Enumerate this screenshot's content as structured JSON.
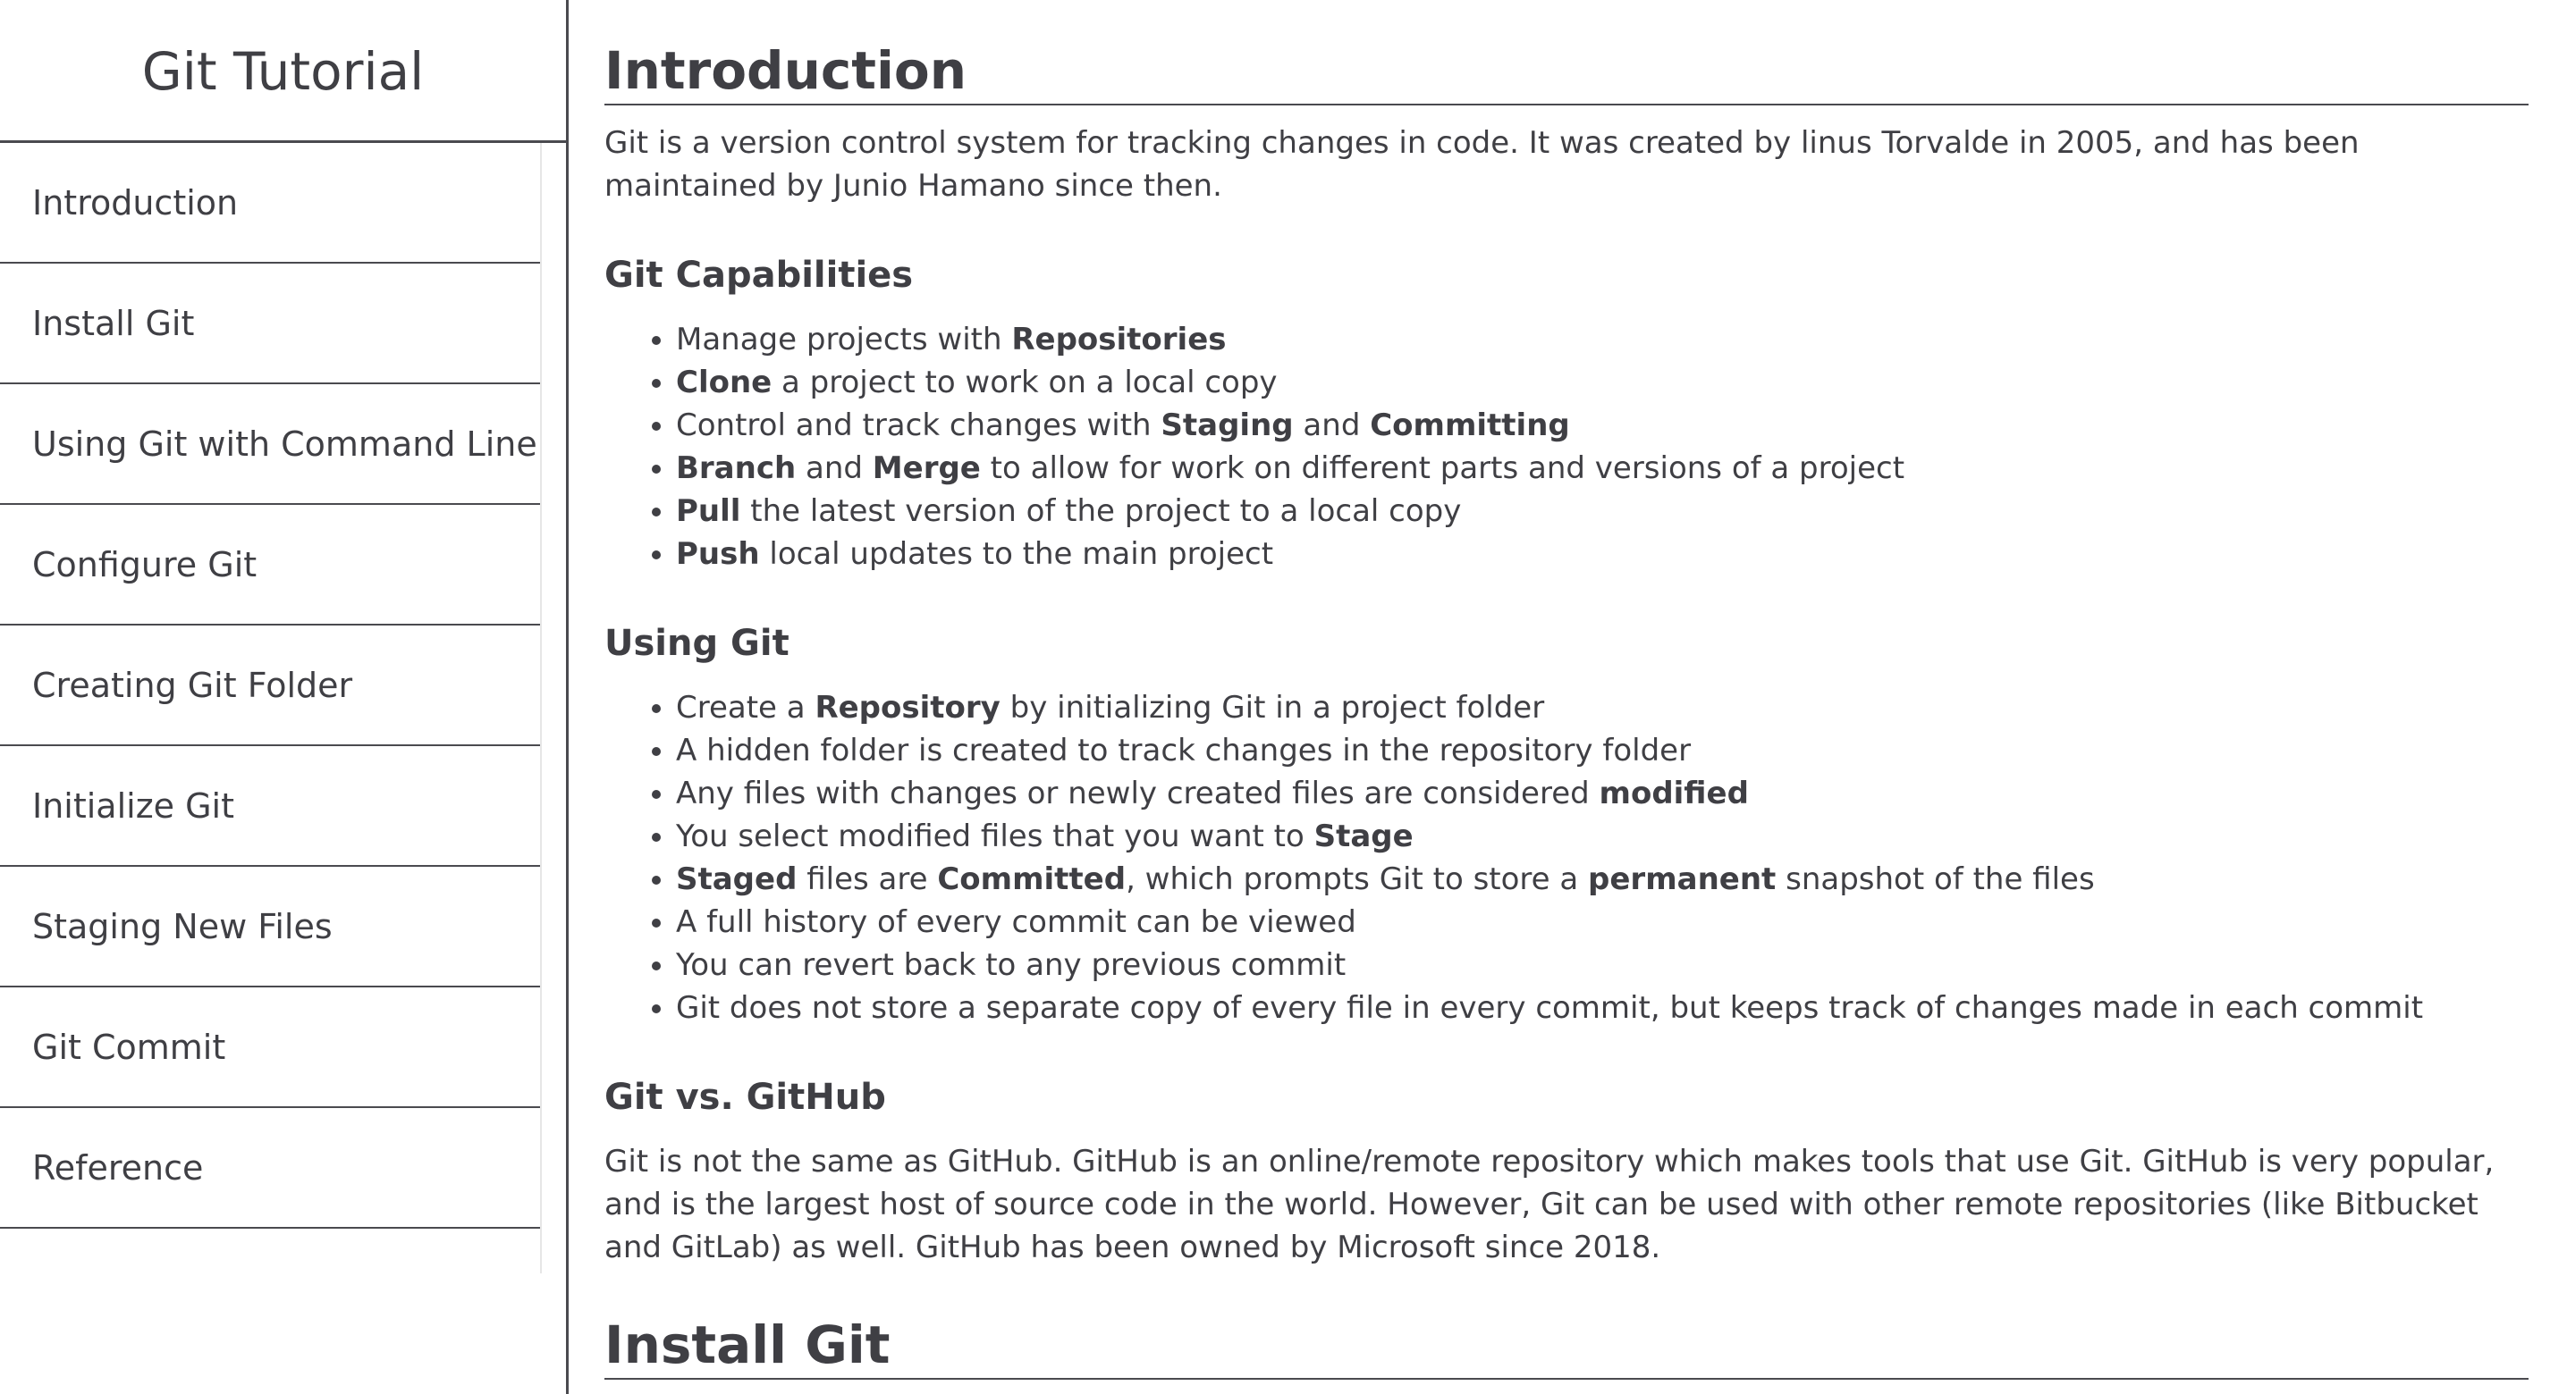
{
  "sidebar": {
    "title": "Git Tutorial",
    "items": [
      {
        "label": "Introduction"
      },
      {
        "label": "Install Git"
      },
      {
        "label": "Using Git with Command Line"
      },
      {
        "label": "Configure Git"
      },
      {
        "label": "Creating Git Folder"
      },
      {
        "label": "Initialize Git"
      },
      {
        "label": "Staging New Files"
      },
      {
        "label": "Git Commit"
      },
      {
        "label": "Reference"
      }
    ]
  },
  "main": {
    "intro_title": "Introduction",
    "intro_paragraph": "Git is a version control system for tracking changes in code. It was created by linus Torvalde in 2005, and has been maintained by Junio Hamano since then.",
    "capabilities": {
      "heading": "Git Capabilities",
      "items": [
        [
          {
            "t": "Manage projects with "
          },
          {
            "t": "Repositories",
            "b": true
          }
        ],
        [
          {
            "t": "Clone",
            "b": true
          },
          {
            "t": " a project to work on a local copy"
          }
        ],
        [
          {
            "t": "Control and track changes with "
          },
          {
            "t": "Staging",
            "b": true
          },
          {
            "t": " and "
          },
          {
            "t": "Committing",
            "b": true
          }
        ],
        [
          {
            "t": "Branch",
            "b": true
          },
          {
            "t": " and "
          },
          {
            "t": "Merge",
            "b": true
          },
          {
            "t": " to allow for work on different parts and versions of a project"
          }
        ],
        [
          {
            "t": "Pull",
            "b": true
          },
          {
            "t": " the latest version of the project to a local copy"
          }
        ],
        [
          {
            "t": "Push",
            "b": true
          },
          {
            "t": " local updates to the main project"
          }
        ]
      ]
    },
    "using_git": {
      "heading": "Using Git",
      "items": [
        [
          {
            "t": "Create a "
          },
          {
            "t": "Repository",
            "b": true
          },
          {
            "t": " by initializing Git in a project folder"
          }
        ],
        [
          {
            "t": "A hidden folder is created to track changes in the repository folder"
          }
        ],
        [
          {
            "t": "Any files with changes or newly created files are considered "
          },
          {
            "t": "modified",
            "b": true
          }
        ],
        [
          {
            "t": "You select modified files that you want to "
          },
          {
            "t": "Stage",
            "b": true
          }
        ],
        [
          {
            "t": "Staged",
            "b": true
          },
          {
            "t": " files are "
          },
          {
            "t": "Committed",
            "b": true
          },
          {
            "t": ", which prompts Git to store a "
          },
          {
            "t": "permanent",
            "b": true
          },
          {
            "t": " snapshot of the files"
          }
        ],
        [
          {
            "t": "A full history of every commit can be viewed"
          }
        ],
        [
          {
            "t": "You can revert back to any previous commit"
          }
        ],
        [
          {
            "t": "Git does not store a separate copy of every file in every commit, but keeps track of changes made in each commit"
          }
        ]
      ]
    },
    "git_vs_github": {
      "heading": "Git vs. GitHub",
      "paragraph": "Git is not the same as GitHub. GitHub is an online/remote repository which makes tools that use Git. GitHub is very popular, and is the largest host of source code in the world. However, Git can be used with other remote repositories (like Bitbucket and GitLab) as well. GitHub has been owned by Microsoft since 2018."
    },
    "install_title": "Install Git"
  }
}
